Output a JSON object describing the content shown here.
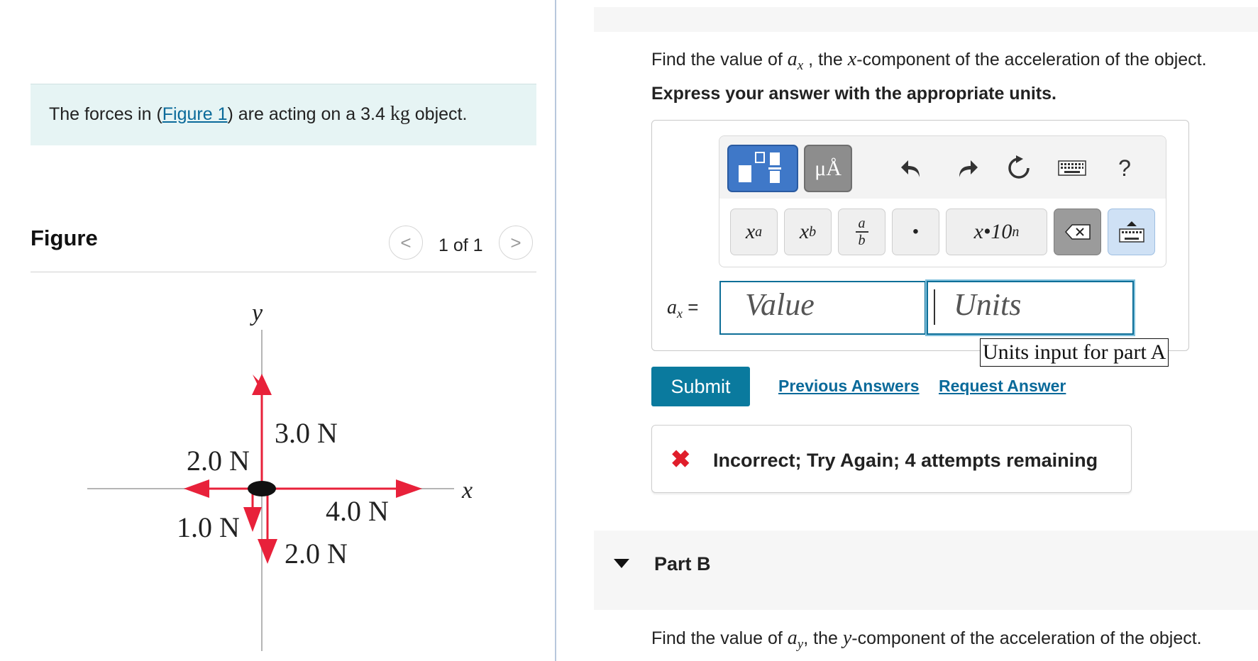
{
  "problem": {
    "text_before_link": "The forces in (",
    "figure_link": "Figure 1",
    "text_after_link": ") are acting on a 3.4 ",
    "mass_unit": "kg",
    "text_end": " object."
  },
  "figure_panel": {
    "heading": "Figure",
    "counter": "1 of 1",
    "prev_glyph": "<",
    "next_glyph": ">",
    "diagram": {
      "y_axis_label": "y",
      "x_axis_label": "x",
      "force_up": "3.0 N",
      "force_left": "2.0 N",
      "force_down_left": "1.0 N",
      "force_right": "4.0 N",
      "force_down": "2.0 N",
      "arrow_color": "#e8213a"
    }
  },
  "part_a": {
    "question_prefix": "Find the value of ",
    "question_var": "a",
    "question_var_sub": "x",
    "question_mid": " , the ",
    "question_axis": "x",
    "question_suffix": "-component of the acceleration of the object.",
    "instruction": "Express your answer with the appropriate units.",
    "toolbar": {
      "templates_icon": "templates-icon",
      "units_symbols_label": "μÅ",
      "help_label": "?",
      "superscript_base": "x",
      "superscript_exp": "a",
      "subscript_base": "x",
      "subscript_index": "b",
      "fraction_top": "a",
      "fraction_bottom": "b",
      "dot_label": "•",
      "sci_notation_label": "x•10",
      "sci_notation_exp": "n"
    },
    "answer_label_var": "a",
    "answer_label_sub": "x",
    "answer_label_eq": " =",
    "value_placeholder": "Value",
    "units_placeholder": "Units",
    "units_tooltip": "Units input for part A",
    "submit_label": "Submit",
    "previous_answers_label": "Previous Answers",
    "request_answer_label": "Request Answer",
    "feedback_icon": "✖",
    "feedback": "Incorrect; Try Again; 4 attempts remaining"
  },
  "part_b": {
    "title": "Part B",
    "question_prefix": "Find the value of ",
    "question_var": "a",
    "question_var_sub": "y",
    "question_mid": ", the ",
    "question_axis": "y",
    "question_suffix": "-component of the acceleration of the object."
  },
  "colors": {
    "accent": "#0a7a9e",
    "link": "#0a6a9a",
    "error": "#e01e2b",
    "problem_bg": "#e6f4f4"
  }
}
